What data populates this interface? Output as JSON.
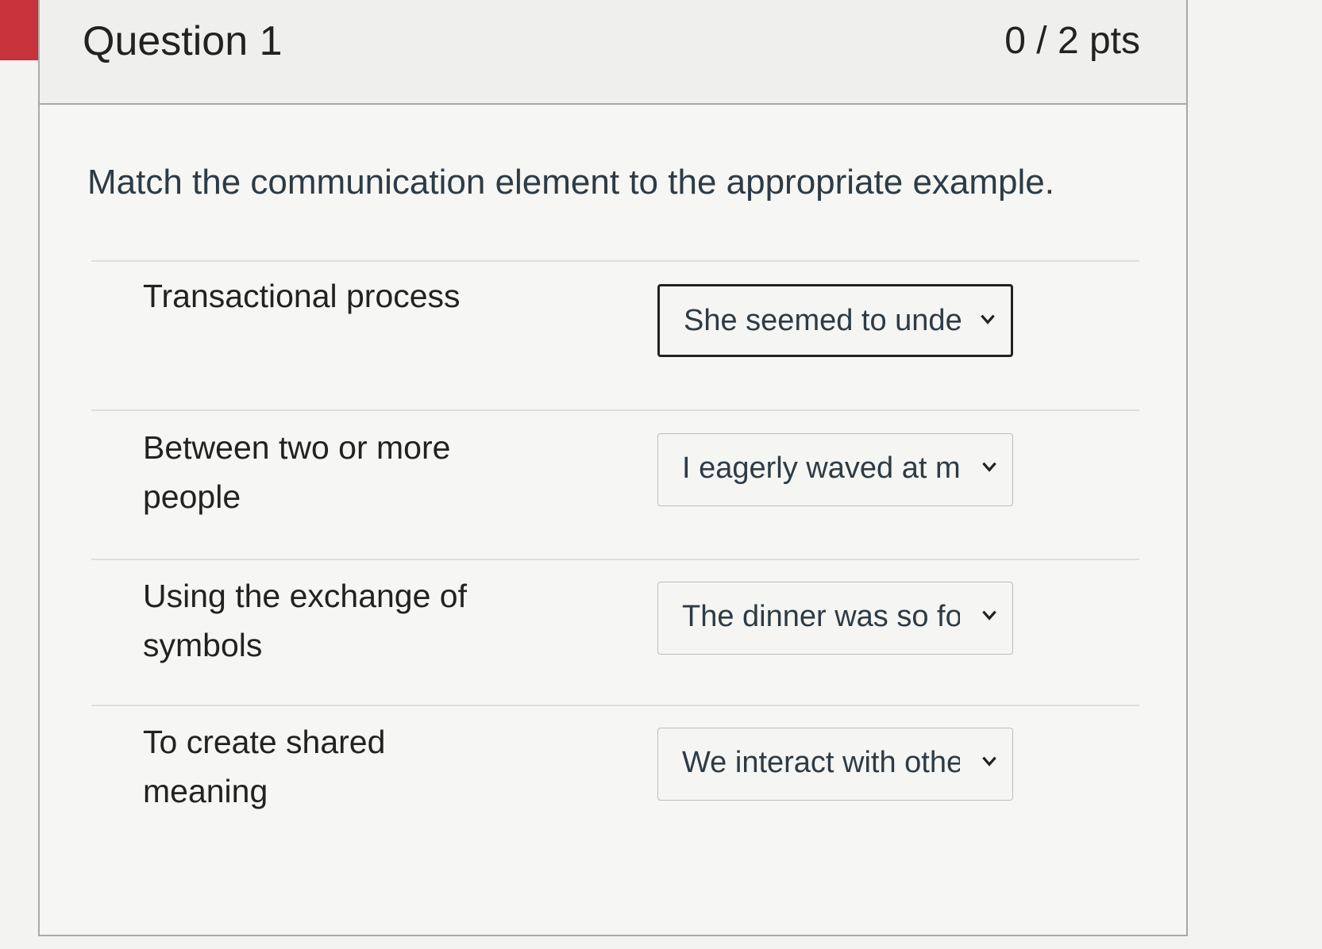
{
  "question": {
    "title": "Question 1",
    "points": "0 / 2 pts",
    "prompt": "Match the communication element to the appropriate example."
  },
  "matches": [
    {
      "label": "Transactional process",
      "selected": "She seemed to unders"
    },
    {
      "label": "Between two or more people",
      "selected": "I eagerly waved at my"
    },
    {
      "label": "Using the exchange of symbols",
      "selected": "The dinner was so for"
    },
    {
      "label": "To create shared meaning",
      "selected": "We interact with othe"
    }
  ],
  "colors": {
    "incorrect_flag": "#c8323a",
    "text": "#2d3b45",
    "border": "#a9a9a7"
  }
}
